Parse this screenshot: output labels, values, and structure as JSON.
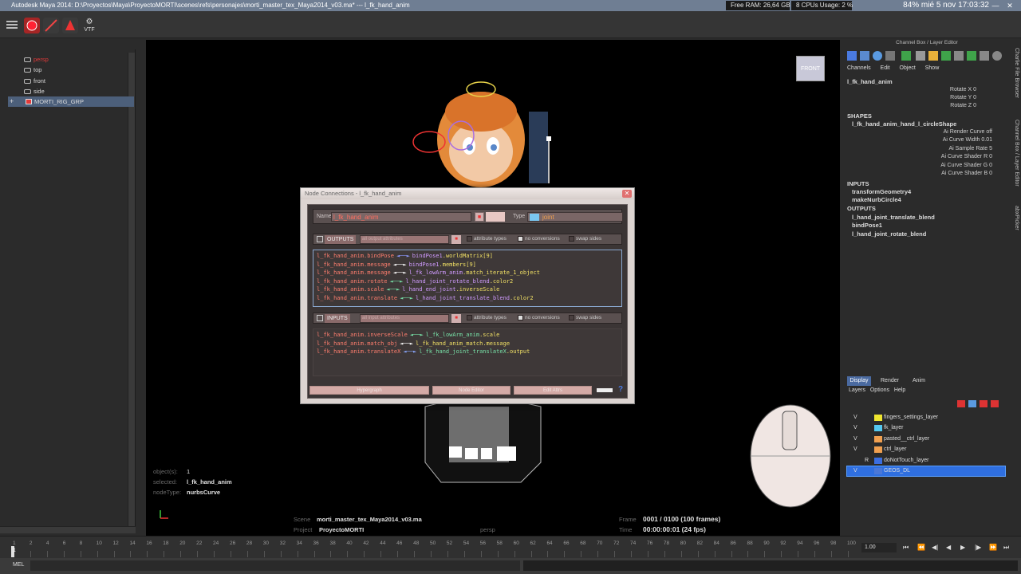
{
  "titlebar": {
    "title": "Autodesk Maya 2014: D:\\Proyectos\\Maya\\ProyectoMORTI\\scenes\\refs\\personajes\\morti_master_tex_Maya2014_v03.ma*   ---   l_fk_hand_anim",
    "free_ram": "Free RAM: 26,64 GB",
    "cpu_usage": "8 CPUs Usage: 2 %",
    "clock": "84% mié 5 nov   17:03:32",
    "minimize": "—",
    "maximize": "▢",
    "close": "✕"
  },
  "toolbar": {
    "tool_label": "VTF"
  },
  "outliner": {
    "items": [
      {
        "label": "persp",
        "color": "#e23a3a"
      },
      {
        "label": "top",
        "color": "#d8d8d8"
      },
      {
        "label": "front",
        "color": "#d8d8d8"
      },
      {
        "label": "side",
        "color": "#d8d8d8"
      },
      {
        "label": "MORTI_RIG_GRP",
        "color": "#d8d8d8"
      }
    ],
    "expand": "+"
  },
  "viewport": {
    "view_cube_label": "FRONT",
    "hud_labels": {
      "objects": "object(s):",
      "selected": "selected:",
      "nodetype": "nodeType:",
      "scene": "Scene",
      "project": "Project",
      "frame": "Frame",
      "time": "Time"
    },
    "hud_values": {
      "objects": "1",
      "selected": "l_fk_hand_anim",
      "nodetype": "nurbsCurve",
      "scene": "morti_master_tex_Maya2014_v03.ma",
      "project": "ProyectoMORTI",
      "frame": "0001 / 0100 (100 frames)",
      "time": "00:00:00:01 (24 fps)",
      "camera": "persp"
    }
  },
  "node_connections": {
    "window_title": "Node Connections - l_fk_hand_anim",
    "name_label": "Name",
    "name_value": "l_fk_hand_anim",
    "type_label": "Type",
    "type_value": "joint",
    "outputs_label": "OUTPUTS",
    "outputs_filter": "all output attributes",
    "inputs_label": "INPUTS",
    "inputs_filter": "all input attributes",
    "attribute_types": "attribute types",
    "no_conversions": "no conversions",
    "swap_sides": "swap sides",
    "outputs": [
      {
        "src": "l_fk_hand_anim.bindPose",
        "arrow": "◄──►",
        "dst_node": "bindPose1",
        "dst_attr": ".worldMatrix[9]",
        "arrow_color": "#8f9aff",
        "dst_color": "#d09bff"
      },
      {
        "src": "l_fk_hand_anim.message",
        "arrow": "◄──►",
        "dst_node": "bindPose1",
        "dst_attr": ".members[9]",
        "arrow_color": "#ffffff",
        "dst_color": "#d09bff"
      },
      {
        "src": "l_fk_hand_anim.message",
        "arrow": "◄──►",
        "dst_node": "l_fk_lowArm_anim",
        "dst_attr": ".match_iterate_1_object",
        "arrow_color": "#ffffff",
        "dst_color": "#d09bff"
      },
      {
        "src": "l_fk_hand_anim.rotate",
        "arrow": "◄──►",
        "dst_node": "l_hand_joint_rotate_blend",
        "dst_attr": ".color2",
        "arrow_color": "#78e2a8",
        "dst_color": "#d09bff"
      },
      {
        "src": "l_fk_hand_anim.scale",
        "arrow": "◄──►",
        "dst_node": "l_hand_end_joint",
        "dst_attr": ".inverseScale",
        "arrow_color": "#78e2a8",
        "dst_color": "#d09bff"
      },
      {
        "src": "l_fk_hand_anim.translate",
        "arrow": "◄──►",
        "dst_node": "l_hand_joint_translate_blend",
        "dst_attr": ".color2",
        "arrow_color": "#78e2a8",
        "dst_color": "#d09bff"
      }
    ],
    "inputs": [
      {
        "src": "l_fk_hand_anim.inverseScale",
        "arrow": "◄──►",
        "dst_node": "l_fk_lowArm_anim",
        "dst_attr": ".scale",
        "arrow_color": "#78e2a8",
        "dst_color": "#78e2a8"
      },
      {
        "src": "l_fk_hand_anim.match_obj",
        "arrow": "◄──►",
        "dst_node": "l_fk_hand_anim_match",
        "dst_attr": ".message",
        "arrow_color": "#ffffff",
        "dst_color": "#f1e065"
      },
      {
        "src": "l_fk_hand_anim.translateX",
        "arrow": "◄──►",
        "dst_node": "l_fk_hand_joint_translateX",
        "dst_attr": ".output",
        "arrow_color": "#8aa8ff",
        "dst_color": "#78e2a8"
      }
    ],
    "buttons": [
      "Hypergraph",
      "Node Editor",
      "Edit Attrs"
    ],
    "help": "?"
  },
  "channel_box": {
    "title": "Channel Box / Layer Editor",
    "menus": [
      "Channels",
      "Edit",
      "Object",
      "Show"
    ],
    "node_name": "l_fk_hand_anim",
    "rotate": [
      {
        "label": "Rotate X",
        "value": "0"
      },
      {
        "label": "Rotate Y",
        "value": "0"
      },
      {
        "label": "Rotate Z",
        "value": "0"
      }
    ],
    "shapes_header": "SHAPES",
    "shape_name": "l_fk_hand_anim_hand_l_circleShape",
    "shape_attrs": [
      {
        "label": "Ai Render Curve",
        "value": "off"
      },
      {
        "label": "Ai Curve Width",
        "value": "0.01"
      },
      {
        "label": "Ai Sample Rate",
        "value": "5"
      },
      {
        "label": "Ai Curve Shader R",
        "value": "0"
      },
      {
        "label": "Ai Curve Shader G",
        "value": "0"
      },
      {
        "label": "Ai Curve Shader B",
        "value": "0"
      }
    ],
    "inputs_header": "INPUTS",
    "inputs": [
      "transformGeometry4",
      "makeNurbCircle4"
    ],
    "outputs_header": "OUTPUTS",
    "outputs": [
      "l_hand_joint_translate_blend",
      "bindPose1",
      "l_hand_joint_rotate_blend"
    ]
  },
  "side_tabs": [
    "Channel Box / Layer Editor",
    "Charlie File Browser",
    "abxPicker"
  ],
  "layer_editor": {
    "tabs": [
      "Display",
      "Render",
      "Anim"
    ],
    "menus": [
      "Layers",
      "Options",
      "Help"
    ],
    "layers": [
      {
        "v": "V",
        "name": "fingers_settings_layer",
        "color": "#f0e630"
      },
      {
        "v": "V",
        "name": "fk_layer",
        "color": "#55c8f0"
      },
      {
        "v": "V",
        "name": "pasted__ctrl_layer",
        "color": "#f0a050"
      },
      {
        "v": "V",
        "name": "ctrl_layer",
        "color": "#f0a050"
      },
      {
        "v": "R",
        "name": "doNotTouch_layer",
        "color": "#3b6ee0"
      },
      {
        "v": "V",
        "name": "GEOS_DL",
        "color": "#4a78d8"
      }
    ]
  },
  "timeline": {
    "ticks": [
      "1",
      "2",
      "4",
      "6",
      "8",
      "10",
      "12",
      "14",
      "16",
      "18",
      "20",
      "22",
      "24",
      "26",
      "28",
      "30",
      "32",
      "34",
      "36",
      "38",
      "40",
      "42",
      "44",
      "46",
      "48",
      "50",
      "52",
      "54",
      "56",
      "58",
      "60",
      "62",
      "64",
      "66",
      "68",
      "70",
      "72",
      "74",
      "76",
      "78",
      "80",
      "82",
      "84",
      "86",
      "88",
      "90",
      "92",
      "94",
      "96",
      "98",
      "100"
    ],
    "current_frame": "1",
    "frame_field": "1.00",
    "controls": [
      "⏮",
      "⏪",
      "◀|",
      "◀",
      "▶",
      "|▶",
      "⏩",
      "⏭"
    ]
  },
  "cmdline": {
    "label": "MEL"
  }
}
